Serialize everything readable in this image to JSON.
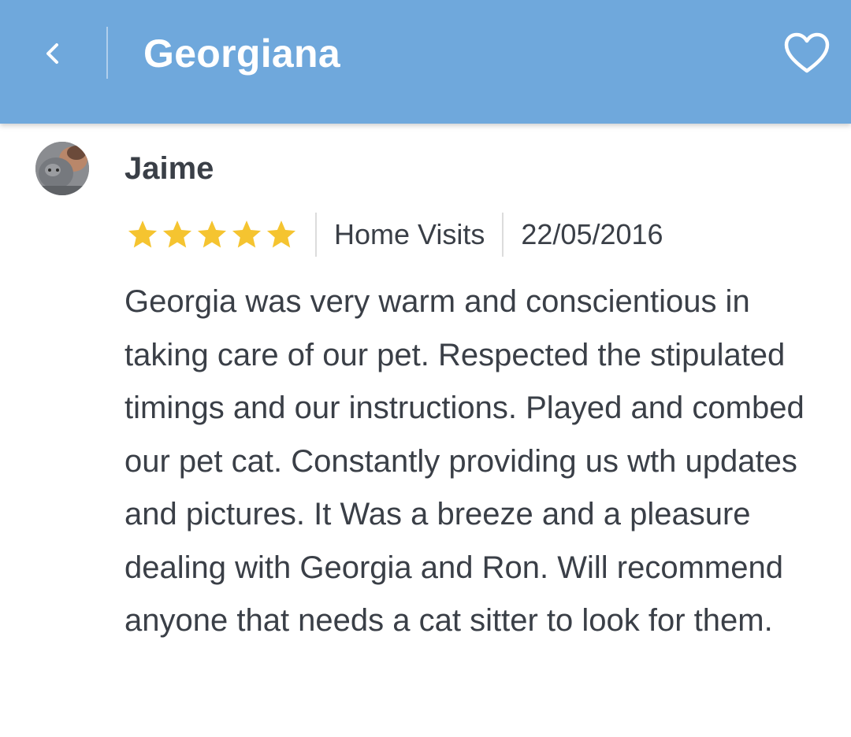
{
  "header": {
    "title": "Georgiana",
    "back_icon": "chevron-left-icon",
    "favorite_icon": "heart-outline-icon",
    "color": "#6fa8dc"
  },
  "review": {
    "reviewer": "Jaime",
    "rating": 5,
    "rating_max": 5,
    "star_color": "#f5c430",
    "service": "Home Visits",
    "date": "22/05/2016",
    "text": "Georgia was very warm and conscientious in taking care of our pet. Respected the stipulated timings and our instructions. Played and combed our pet cat. Constantly providing us wth updates and pictures. It Was a breeze and a pleasure dealing with Georgia and Ron. Will recommend anyone that needs a cat sitter to look for them."
  }
}
